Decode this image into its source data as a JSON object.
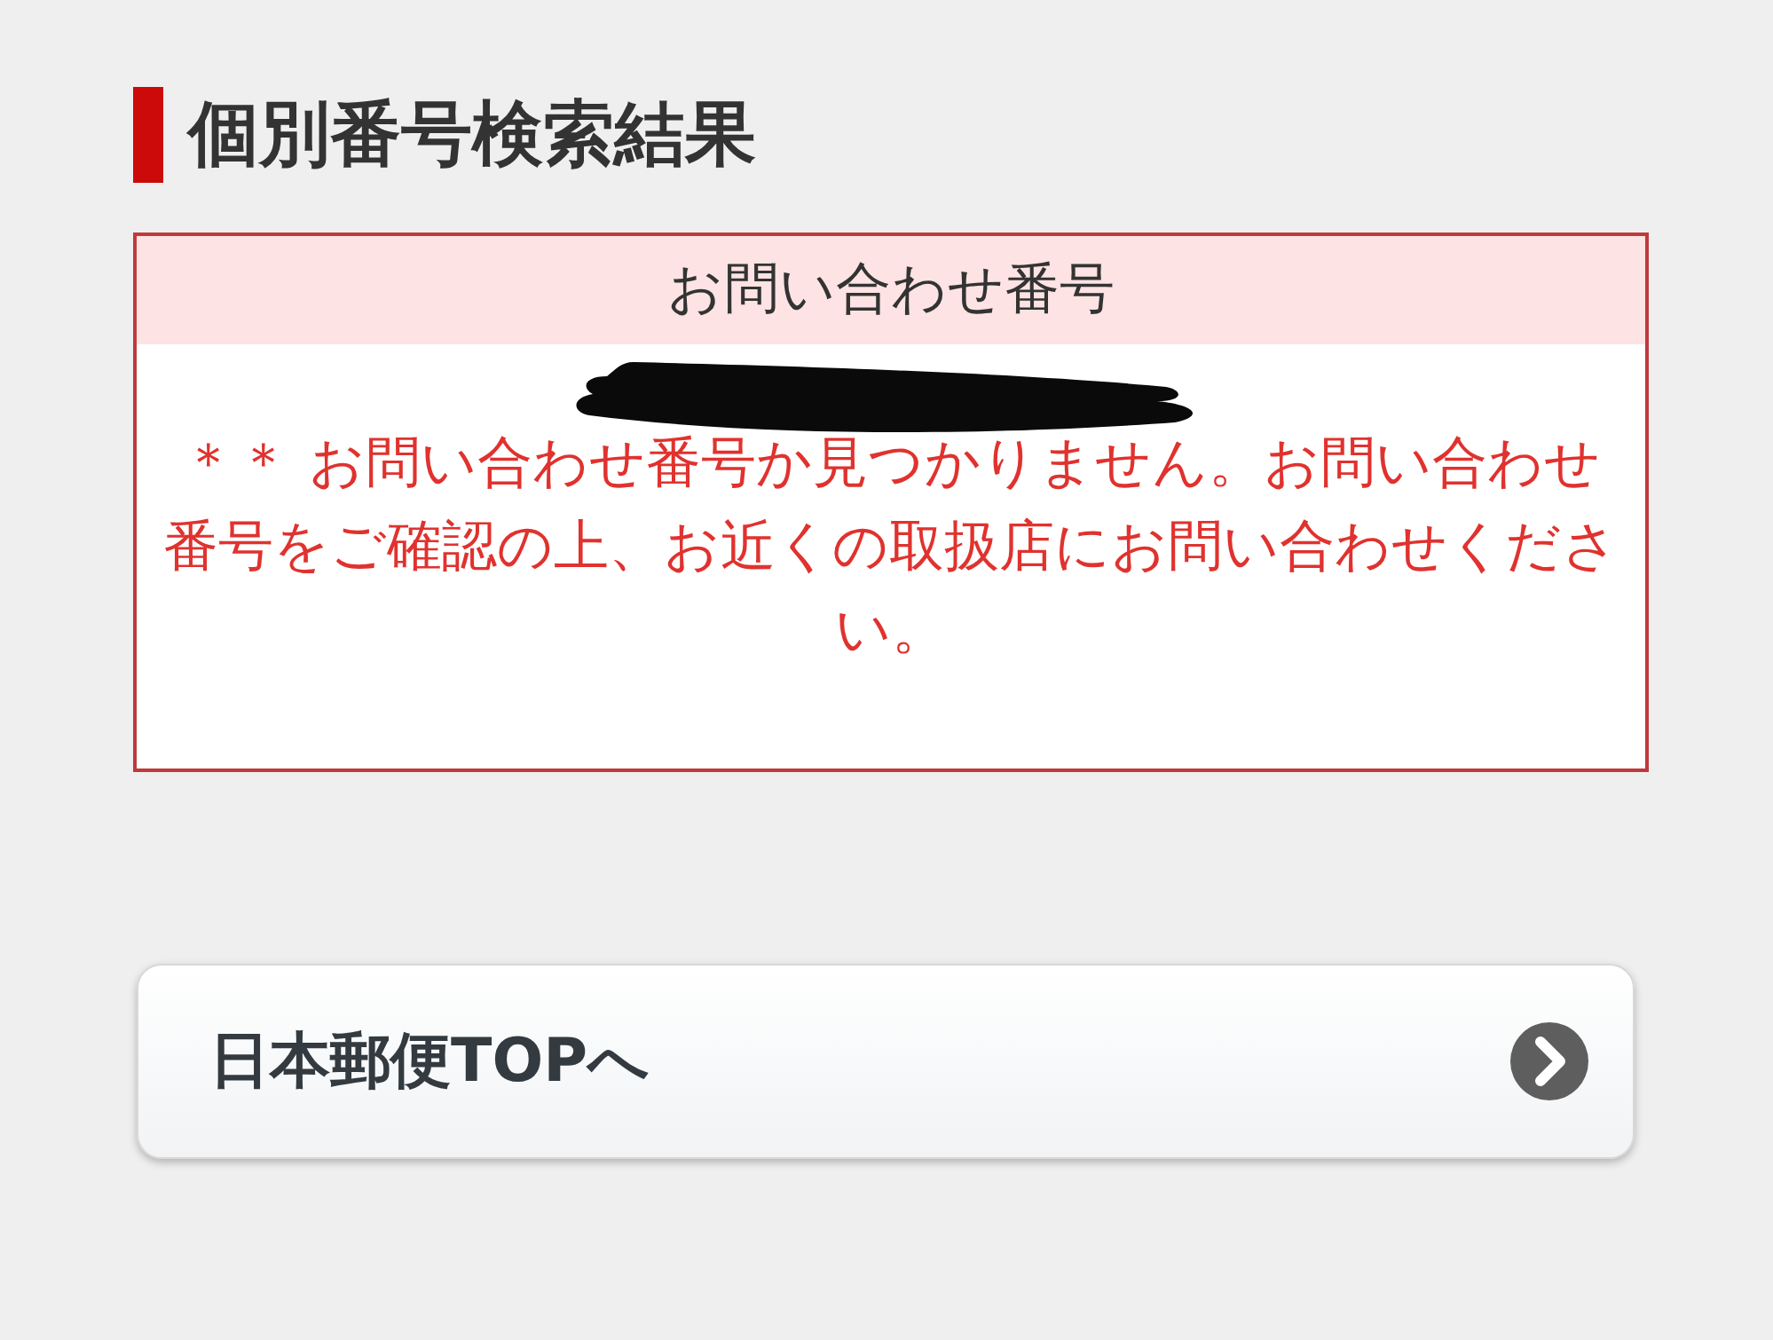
{
  "heading": "個別番号検索結果",
  "result_box": {
    "header": "お問い合わせ番号",
    "message": "＊＊ お問い合わせ番号か見つかりません。お問い合わせ番号をご確認の上、お近くの取扱店にお問い合わせください。"
  },
  "link_button": {
    "label": "日本郵便TOPへ"
  }
}
